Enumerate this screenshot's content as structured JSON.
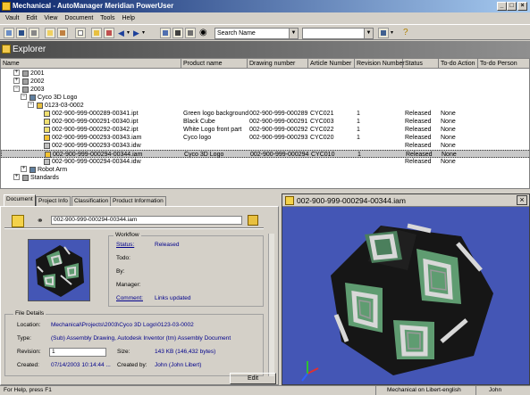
{
  "window": {
    "title": "Mechanical - AutoManager Meridian PowerUser",
    "controls": {
      "minimize": "_",
      "maximize": "□",
      "close": "×"
    }
  },
  "menu": [
    "Vault",
    "Edit",
    "View",
    "Document",
    "Tools",
    "Help"
  ],
  "toolbar": {
    "search_combo": "Search Name",
    "combo_second": "",
    "icons": [
      "open-icon",
      "save-icon",
      "print-icon",
      "copy-icon",
      "paste-icon",
      "folder-up-icon",
      "back-icon",
      "forward-icon",
      "up-icon",
      "view-list-icon",
      "view-details-icon",
      "view-thumbs-icon",
      "find-icon",
      "help-icon"
    ]
  },
  "explorer": {
    "title": "Explorer",
    "columns": [
      "Name",
      "Product name",
      "Drawing number",
      "Article Number",
      "Revision Number",
      "Status",
      "To-do Action",
      "To-do Person"
    ],
    "rows": [
      {
        "name": "2001",
        "indent": 2,
        "expander": "+",
        "icon": "cabinet-icon"
      },
      {
        "name": "2002",
        "indent": 2,
        "expander": "+",
        "icon": "cabinet-icon"
      },
      {
        "name": "2003",
        "indent": 2,
        "expander": "−",
        "icon": "cabinet-icon"
      },
      {
        "name": "Cyco 3D Logo",
        "indent": 3,
        "expander": "−",
        "icon": "project-icon"
      },
      {
        "name": "0123-03-0002",
        "indent": 4,
        "expander": "−",
        "icon": "folder-icon"
      },
      {
        "name": "002-900-999-000289-00341.ipt",
        "indent": 5,
        "icon": "part-icon",
        "product": "Green logo background",
        "drawing": "002-900-999-000289",
        "article": "CYC021",
        "revision": "1",
        "status": "Released",
        "todo": "None"
      },
      {
        "name": "002-900-999-000291-00340.ipt",
        "indent": 5,
        "icon": "part-icon",
        "product": "Black Cube",
        "drawing": "002-900-999-000291",
        "article": "CYC003",
        "revision": "1",
        "status": "Released",
        "todo": "None"
      },
      {
        "name": "002-900-999-000292-00342.ipt",
        "indent": 5,
        "icon": "part-icon",
        "product": "White Logo front part",
        "drawing": "002-900-999-000292",
        "article": "CYC022",
        "revision": "1",
        "status": "Released",
        "todo": "None"
      },
      {
        "name": "002-900-999-000293-00343.iam",
        "indent": 5,
        "icon": "assembly-icon",
        "product": "Cyco logo",
        "drawing": "002-900-999-000293",
        "article": "CYC020",
        "revision": "1",
        "status": "Released",
        "todo": "None"
      },
      {
        "name": "002-900-999-000293-00343.idw",
        "indent": 5,
        "icon": "drawing-icon",
        "product": "",
        "drawing": "",
        "article": "",
        "revision": "",
        "status": "Released",
        "todo": "None"
      },
      {
        "name": "002-900-999-000294-00344.iam",
        "indent": 5,
        "icon": "assembly-icon",
        "product": "Cyco 3D Logo",
        "drawing": "002-900-999-000294",
        "article": "CYC010",
        "revision": "1",
        "status": "Released",
        "todo": "None",
        "selected": true
      },
      {
        "name": "002-900-999-000294-00344.idw",
        "indent": 5,
        "icon": "drawing-icon",
        "product": "",
        "drawing": "",
        "article": "",
        "revision": "",
        "status": "Released",
        "todo": "None"
      },
      {
        "name": "Robot Arm",
        "indent": 3,
        "expander": "+",
        "icon": "project-icon"
      },
      {
        "name": "Standards",
        "indent": 2,
        "expander": "+",
        "icon": "cabinet-icon"
      }
    ]
  },
  "tabs": [
    "Document",
    "Project Info",
    "Classification",
    "Product Information"
  ],
  "document": {
    "filename": "002-900-999-000294-00344.iam",
    "workflow": {
      "heading": "Workflow",
      "status_label": "Status:",
      "status_value": "Released",
      "todo_label": "Todo:",
      "by_label": "By:",
      "manager_label": "Manager:",
      "comment_label": "Comment:",
      "comment_value": "Links updated"
    },
    "details": {
      "heading": "File Details",
      "location_label": "Location:",
      "location_value": "Mechanical\\Projects\\2003\\Cyco 3D Logo\\0123-03-0002",
      "type_label": "Type:",
      "type_value": "(Sub) Assembly Drawing, Autodesk Inventor (tm) Assembly Document",
      "revision_label": "Revision:",
      "revision_value": "1",
      "size_label": "Size:",
      "size_value": "143 KB (146,432 bytes)",
      "created_label": "Created:",
      "created_value": "07/14/2003 10:14:44 ...",
      "created_by_label": "Created by:",
      "created_by_value": "John (John Libert)"
    },
    "edit_button": "Edit"
  },
  "viewer": {
    "title": "002-900-999-000294-00344.iam",
    "close": "×"
  },
  "statusbar": {
    "help": "For Help, press F1",
    "vault": "Mechanical on Libert-english",
    "user": "John"
  },
  "colors": {
    "title_start": "#0a246a",
    "title_end": "#a6caf0",
    "viewer_bg": "#4456b5",
    "cube_black": "#161616",
    "cube_green": "#5f9c71",
    "logo_white": "#d8d8d8"
  }
}
